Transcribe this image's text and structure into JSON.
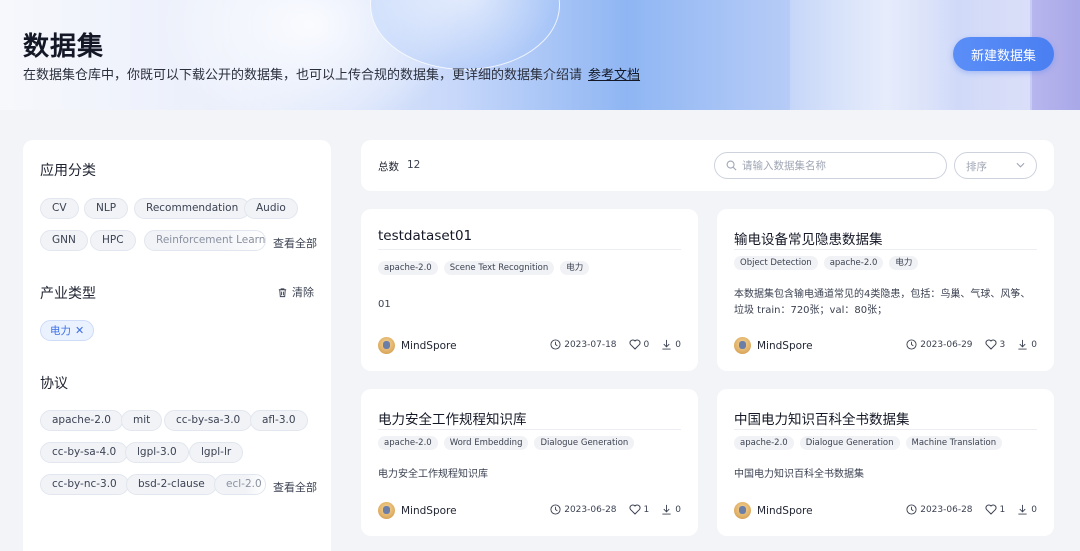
{
  "banner": {
    "title": "数据集",
    "description": "在数据集仓库中，你既可以下载公开的数据集，也可以上传合规的数据集，更详细的数据集介绍请",
    "doc_link": "参考文档",
    "new_button": "新建数据集"
  },
  "filters": {
    "app_category": {
      "title": "应用分类",
      "chips": [
        "CV",
        "NLP",
        "Recommendation",
        "Audio",
        "GNN",
        "HPC",
        "Reinforcement Learning"
      ],
      "see_all": "查看全部"
    },
    "industry": {
      "title": "产业类型",
      "clear": "清除",
      "selected": "电力"
    },
    "license": {
      "title": "协议",
      "chips": [
        "apache-2.0",
        "mit",
        "cc-by-sa-3.0",
        "afl-3.0",
        "cc-by-sa-4.0",
        "lgpl-3.0",
        "lgpl-lr",
        "cc-by-nc-3.0",
        "bsd-2-clause",
        "ecl-2.0"
      ],
      "see_all": "查看全部"
    }
  },
  "toolbar": {
    "total_label": "总数",
    "total_count": "12",
    "search_placeholder": "请输入数据集名称",
    "sort_label": "排序"
  },
  "cards": [
    {
      "title": "testdataset01",
      "tags": [
        "apache-2.0",
        "Scene Text Recognition",
        "电力"
      ],
      "description": "01",
      "owner": "MindSpore",
      "date": "2023-07-18",
      "likes": "0",
      "downloads": "0"
    },
    {
      "title": "输电设备常见隐患数据集",
      "tags": [
        "Object Detection",
        "apache-2.0",
        "电力"
      ],
      "description": "本数据集包含输电通道常见的4类隐患，包括：鸟巢、气球、风筝、垃圾 train：720张；val：80张；",
      "owner": "MindSpore",
      "date": "2023-06-29",
      "likes": "3",
      "downloads": "0"
    },
    {
      "title": "电力安全工作规程知识库",
      "tags": [
        "apache-2.0",
        "Word Embedding",
        "Dialogue Generation"
      ],
      "description": "电力安全工作规程知识库",
      "owner": "MindSpore",
      "date": "2023-06-28",
      "likes": "1",
      "downloads": "0"
    },
    {
      "title": "中国电力知识百科全书数据集",
      "tags": [
        "apache-2.0",
        "Dialogue Generation",
        "Machine Translation"
      ],
      "description": "中国电力知识百科全书数据集",
      "owner": "MindSpore",
      "date": "2023-06-28",
      "likes": "1",
      "downloads": "0"
    }
  ],
  "colors": {
    "accent": "#4a7ff2",
    "page_bg": "#f2f4f8",
    "selected_chip_text": "#3b6fe6"
  }
}
